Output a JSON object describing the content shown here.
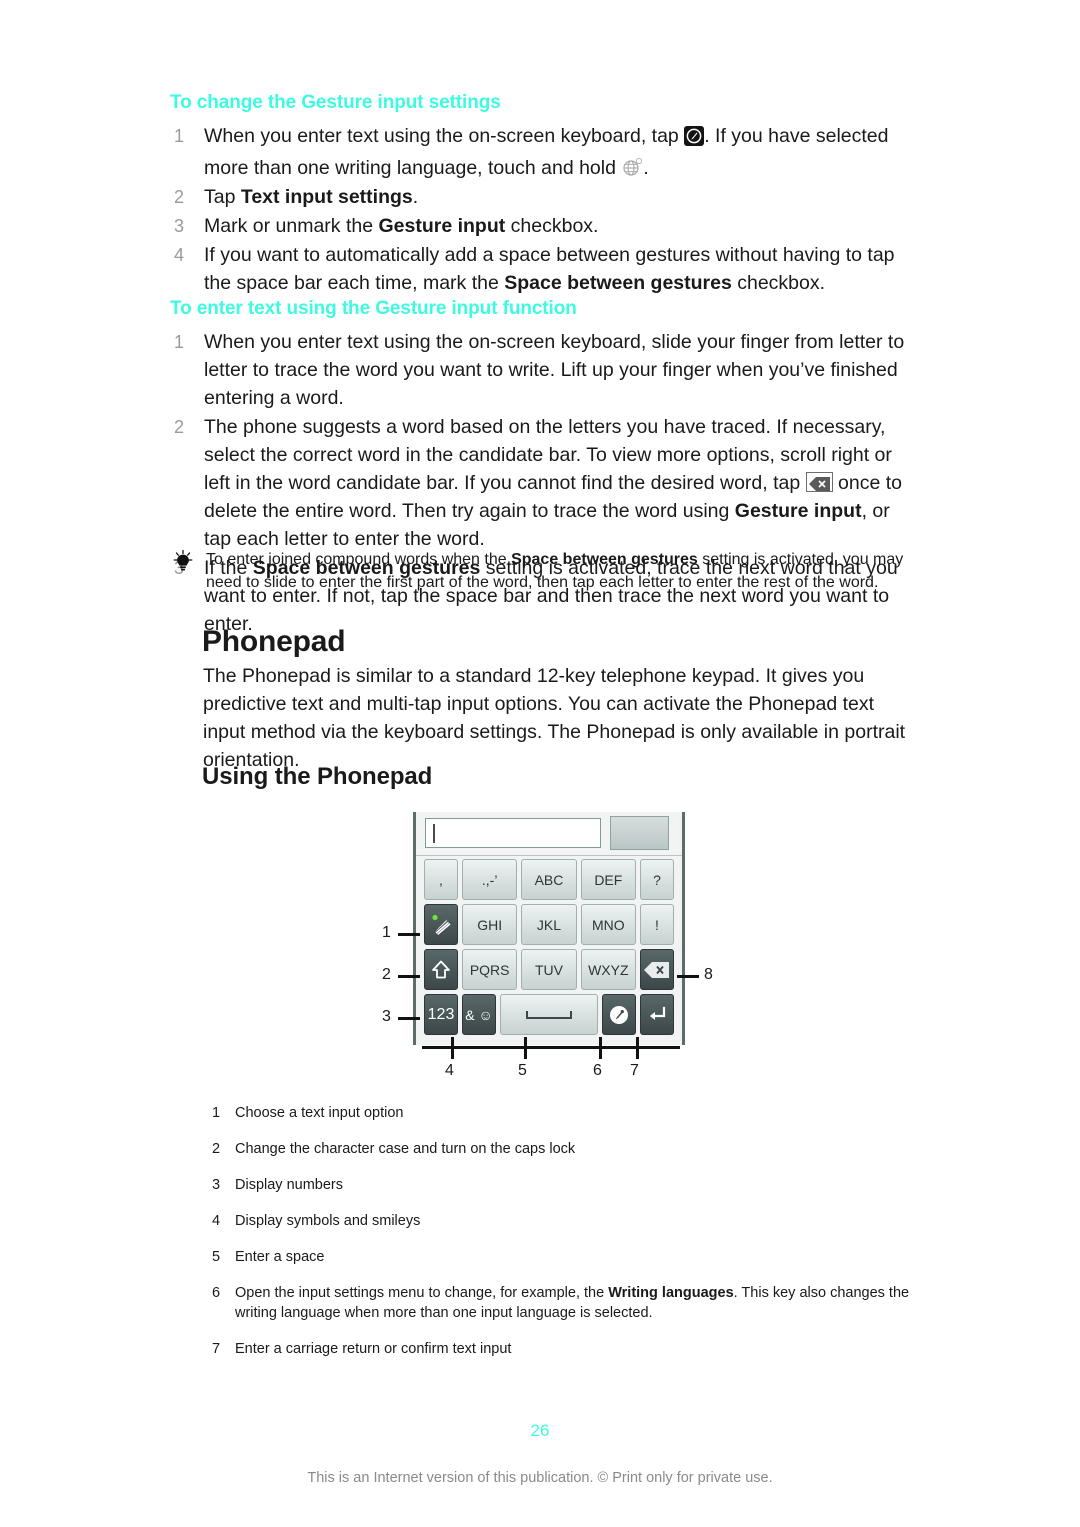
{
  "sections": [
    {
      "heading": "To change the Gesture input settings",
      "steps": [
        {
          "num": "1",
          "parts": [
            {
              "t": "When you enter text using the on-screen keyboard, tap "
            },
            {
              "icon": "settings-key-icon"
            },
            {
              "t": ". If you have selected more than one writing language, touch and hold "
            },
            {
              "icon": "globe-icon"
            },
            {
              "t": "."
            }
          ]
        },
        {
          "num": "2",
          "parts": [
            {
              "t": "Tap "
            },
            {
              "t": "Text input settings",
              "bold": true
            },
            {
              "t": "."
            }
          ]
        },
        {
          "num": "3",
          "parts": [
            {
              "t": "Mark or unmark the "
            },
            {
              "t": "Gesture input",
              "bold": true
            },
            {
              "t": " checkbox."
            }
          ]
        },
        {
          "num": "4",
          "parts": [
            {
              "t": "If you want to automatically add a space between gestures without having to tap the space bar each time, mark the "
            },
            {
              "t": "Space between gestures",
              "bold": true
            },
            {
              "t": " checkbox."
            }
          ]
        }
      ]
    },
    {
      "heading": "To enter text using the Gesture input function",
      "steps": [
        {
          "num": "1",
          "parts": [
            {
              "t": "When you enter text using the on-screen keyboard, slide your finger from letter to letter to trace the word you want to write. Lift up your finger when you’ve finished entering a word."
            }
          ]
        },
        {
          "num": "2",
          "parts": [
            {
              "t": "The phone suggests a word based on the letters you have traced. If necessary, select the correct word in the candidate bar. To view more options, scroll right or left in the word candidate bar. If you cannot find the desired word, tap "
            },
            {
              "icon": "delete-key-icon"
            },
            {
              "t": " once to delete the entire word. Then try again to trace the word using "
            },
            {
              "t": "Gesture input",
              "bold": true
            },
            {
              "t": ", or tap each letter to enter the word."
            }
          ]
        },
        {
          "num": "3",
          "parts": [
            {
              "t": "If the "
            },
            {
              "t": "Space between gestures",
              "bold": true
            },
            {
              "t": " setting is activated, trace the next word that you want to enter. If not, tap the space bar and then trace the next word you want to enter."
            }
          ]
        }
      ]
    }
  ],
  "tip": {
    "icon": "lightbulb-icon",
    "parts": [
      {
        "t": "To enter joined compound words when the "
      },
      {
        "t": "Space between gestures",
        "bold": true
      },
      {
        "t": " setting is activated, you may need to slide to enter the first part of the word, then tap each letter to enter the rest of the word."
      }
    ]
  },
  "phonepad": {
    "title": "Phonepad",
    "body": "The Phonepad is similar to a standard 12-key telephone keypad. It gives you predictive text and multi-tap input options. You can activate the Phonepad text input method via the keyboard settings. The Phonepad is only available in portrait orientation.",
    "section_title": "Using the Phonepad"
  },
  "keypad": {
    "candidate_value": "",
    "rows": [
      [
        {
          "label": ",",
          "style": "light",
          "width": "xnarrow",
          "name": "key-comma"
        },
        {
          "label": ".,-’",
          "style": "light",
          "width": "normal",
          "name": "key-punctuation"
        },
        {
          "label": "ABC",
          "style": "light",
          "width": "normal",
          "name": "key-abc"
        },
        {
          "label": "DEF",
          "style": "light",
          "width": "normal",
          "name": "key-def"
        },
        {
          "label": "?",
          "style": "light",
          "width": "xnarrow",
          "name": "key-question"
        }
      ],
      [
        {
          "label": "",
          "style": "dark",
          "width": "xnarrow",
          "name": "key-text-input-option",
          "icon": "pencil-stack-icon"
        },
        {
          "label": "GHI",
          "style": "light",
          "width": "normal",
          "name": "key-ghi"
        },
        {
          "label": "JKL",
          "style": "light",
          "width": "normal",
          "name": "key-jkl"
        },
        {
          "label": "MNO",
          "style": "light",
          "width": "normal",
          "name": "key-mno"
        },
        {
          "label": "!",
          "style": "light",
          "width": "xnarrow",
          "name": "key-exclamation"
        }
      ],
      [
        {
          "label": "",
          "style": "dark",
          "width": "xnarrow",
          "name": "key-shift",
          "icon": "shift-arrow-icon"
        },
        {
          "label": "PQRS",
          "style": "light",
          "width": "normal",
          "name": "key-pqrs"
        },
        {
          "label": "TUV",
          "style": "light",
          "width": "normal",
          "name": "key-tuv"
        },
        {
          "label": "WXYZ",
          "style": "light",
          "width": "normal",
          "name": "key-wxyz"
        },
        {
          "label": "",
          "style": "dark",
          "width": "xnarrow",
          "name": "key-backspace",
          "icon": "backspace-icon"
        }
      ],
      [
        {
          "label": "123",
          "style": "dark",
          "width": "xnarrow",
          "name": "key-numbers"
        },
        {
          "label": "& ☺",
          "style": "dark",
          "width": "xnarrow",
          "name": "key-symbols-smileys"
        },
        {
          "label": "",
          "style": "light",
          "width": "wide",
          "name": "key-space",
          "icon": "space-icon"
        },
        {
          "label": "",
          "style": "dark",
          "width": "xnarrow",
          "name": "key-input-settings",
          "icon": "settings-circle-icon"
        },
        {
          "label": "",
          "style": "dark",
          "width": "xnarrow",
          "name": "key-enter",
          "icon": "enter-arrow-icon"
        }
      ]
    ],
    "callouts": [
      "1",
      "2",
      "3",
      "4",
      "5",
      "6",
      "7",
      "8"
    ]
  },
  "legend": [
    {
      "n": "1",
      "parts": [
        {
          "t": "Choose a text input option"
        }
      ]
    },
    {
      "n": "2",
      "parts": [
        {
          "t": "Change the character case and turn on the caps lock"
        }
      ]
    },
    {
      "n": "3",
      "parts": [
        {
          "t": "Display numbers"
        }
      ]
    },
    {
      "n": "4",
      "parts": [
        {
          "t": "Display symbols and smileys"
        }
      ]
    },
    {
      "n": "5",
      "parts": [
        {
          "t": "Enter a space"
        }
      ]
    },
    {
      "n": "6",
      "parts": [
        {
          "t": "Open the input settings menu to change, for example, the "
        },
        {
          "t": "Writing languages",
          "bold": true
        },
        {
          "t": ". This key also changes the writing language when more than one input language is selected."
        }
      ]
    },
    {
      "n": "7",
      "parts": [
        {
          "t": "Enter a carriage return or confirm text input"
        }
      ]
    }
  ],
  "footer": {
    "page_number": "26",
    "note": "This is an Internet version of this publication. © Print only for private use."
  },
  "colors": {
    "accent_cyan": "#3dfbe0",
    "body_text": "#1a1a1a",
    "step_number": "#9a9a9a",
    "footnote": "#8a8a8a"
  }
}
